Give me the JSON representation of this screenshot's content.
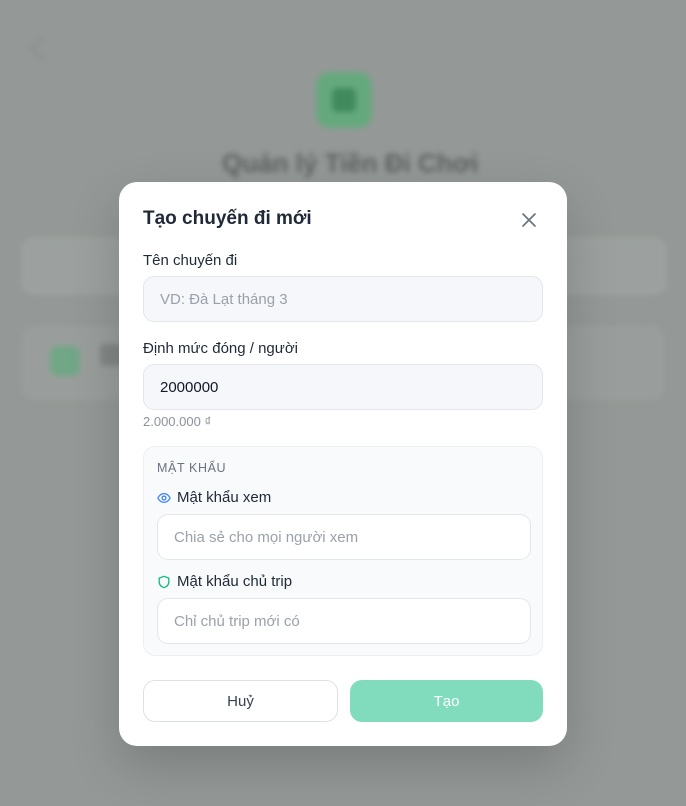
{
  "background": {
    "title": "Quản lý Tiền Đi Chơi"
  },
  "modal": {
    "title": "Tạo chuyến đi mới",
    "trip_name": {
      "label": "Tên chuyến đi",
      "placeholder": "VD: Đà Lạt tháng 3",
      "value": ""
    },
    "quota": {
      "label": "Định mức đóng / người",
      "value": "2000000",
      "formatted": "2.000.000 ₫"
    },
    "password": {
      "heading": "MẬT KHẨU",
      "view": {
        "label": "Mật khẩu xem",
        "placeholder": "Chia sẻ cho mọi người xem",
        "icon": "eye-icon"
      },
      "owner": {
        "label": "Mật khẩu chủ trip",
        "placeholder": "Chỉ chủ trip mới có",
        "icon": "shield-icon"
      }
    },
    "buttons": {
      "cancel": "Huỷ",
      "create": "Tạo"
    }
  },
  "colors": {
    "accent": "#10b981",
    "eye_icon": "#3b82f6",
    "create_disabled": "#80dcbd"
  }
}
